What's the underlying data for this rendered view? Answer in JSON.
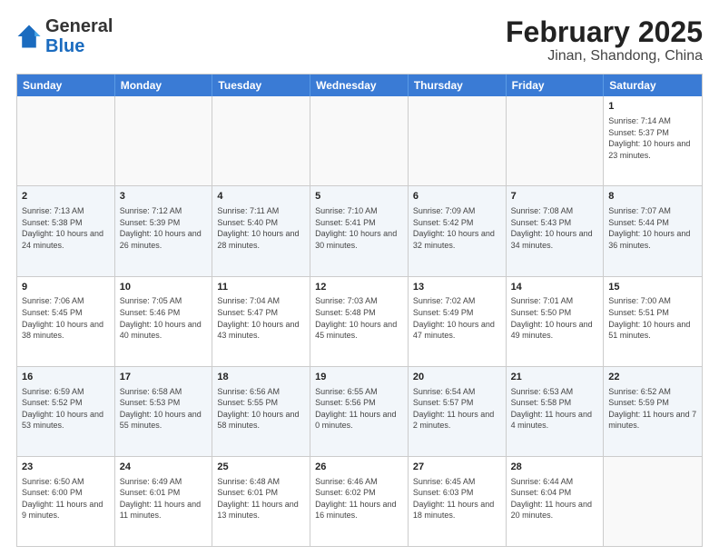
{
  "logo": {
    "general": "General",
    "blue": "Blue"
  },
  "title": "February 2025",
  "subtitle": "Jinan, Shandong, China",
  "weekdays": [
    "Sunday",
    "Monday",
    "Tuesday",
    "Wednesday",
    "Thursday",
    "Friday",
    "Saturday"
  ],
  "weeks": [
    [
      {
        "day": "",
        "text": "",
        "empty": true
      },
      {
        "day": "",
        "text": "",
        "empty": true
      },
      {
        "day": "",
        "text": "",
        "empty": true
      },
      {
        "day": "",
        "text": "",
        "empty": true
      },
      {
        "day": "",
        "text": "",
        "empty": true
      },
      {
        "day": "",
        "text": "",
        "empty": true
      },
      {
        "day": "1",
        "text": "Sunrise: 7:14 AM\nSunset: 5:37 PM\nDaylight: 10 hours and 23 minutes.",
        "empty": false
      }
    ],
    [
      {
        "day": "2",
        "text": "Sunrise: 7:13 AM\nSunset: 5:38 PM\nDaylight: 10 hours and 24 minutes.",
        "empty": false
      },
      {
        "day": "3",
        "text": "Sunrise: 7:12 AM\nSunset: 5:39 PM\nDaylight: 10 hours and 26 minutes.",
        "empty": false
      },
      {
        "day": "4",
        "text": "Sunrise: 7:11 AM\nSunset: 5:40 PM\nDaylight: 10 hours and 28 minutes.",
        "empty": false
      },
      {
        "day": "5",
        "text": "Sunrise: 7:10 AM\nSunset: 5:41 PM\nDaylight: 10 hours and 30 minutes.",
        "empty": false
      },
      {
        "day": "6",
        "text": "Sunrise: 7:09 AM\nSunset: 5:42 PM\nDaylight: 10 hours and 32 minutes.",
        "empty": false
      },
      {
        "day": "7",
        "text": "Sunrise: 7:08 AM\nSunset: 5:43 PM\nDaylight: 10 hours and 34 minutes.",
        "empty": false
      },
      {
        "day": "8",
        "text": "Sunrise: 7:07 AM\nSunset: 5:44 PM\nDaylight: 10 hours and 36 minutes.",
        "empty": false
      }
    ],
    [
      {
        "day": "9",
        "text": "Sunrise: 7:06 AM\nSunset: 5:45 PM\nDaylight: 10 hours and 38 minutes.",
        "empty": false
      },
      {
        "day": "10",
        "text": "Sunrise: 7:05 AM\nSunset: 5:46 PM\nDaylight: 10 hours and 40 minutes.",
        "empty": false
      },
      {
        "day": "11",
        "text": "Sunrise: 7:04 AM\nSunset: 5:47 PM\nDaylight: 10 hours and 43 minutes.",
        "empty": false
      },
      {
        "day": "12",
        "text": "Sunrise: 7:03 AM\nSunset: 5:48 PM\nDaylight: 10 hours and 45 minutes.",
        "empty": false
      },
      {
        "day": "13",
        "text": "Sunrise: 7:02 AM\nSunset: 5:49 PM\nDaylight: 10 hours and 47 minutes.",
        "empty": false
      },
      {
        "day": "14",
        "text": "Sunrise: 7:01 AM\nSunset: 5:50 PM\nDaylight: 10 hours and 49 minutes.",
        "empty": false
      },
      {
        "day": "15",
        "text": "Sunrise: 7:00 AM\nSunset: 5:51 PM\nDaylight: 10 hours and 51 minutes.",
        "empty": false
      }
    ],
    [
      {
        "day": "16",
        "text": "Sunrise: 6:59 AM\nSunset: 5:52 PM\nDaylight: 10 hours and 53 minutes.",
        "empty": false
      },
      {
        "day": "17",
        "text": "Sunrise: 6:58 AM\nSunset: 5:53 PM\nDaylight: 10 hours and 55 minutes.",
        "empty": false
      },
      {
        "day": "18",
        "text": "Sunrise: 6:56 AM\nSunset: 5:55 PM\nDaylight: 10 hours and 58 minutes.",
        "empty": false
      },
      {
        "day": "19",
        "text": "Sunrise: 6:55 AM\nSunset: 5:56 PM\nDaylight: 11 hours and 0 minutes.",
        "empty": false
      },
      {
        "day": "20",
        "text": "Sunrise: 6:54 AM\nSunset: 5:57 PM\nDaylight: 11 hours and 2 minutes.",
        "empty": false
      },
      {
        "day": "21",
        "text": "Sunrise: 6:53 AM\nSunset: 5:58 PM\nDaylight: 11 hours and 4 minutes.",
        "empty": false
      },
      {
        "day": "22",
        "text": "Sunrise: 6:52 AM\nSunset: 5:59 PM\nDaylight: 11 hours and 7 minutes.",
        "empty": false
      }
    ],
    [
      {
        "day": "23",
        "text": "Sunrise: 6:50 AM\nSunset: 6:00 PM\nDaylight: 11 hours and 9 minutes.",
        "empty": false
      },
      {
        "day": "24",
        "text": "Sunrise: 6:49 AM\nSunset: 6:01 PM\nDaylight: 11 hours and 11 minutes.",
        "empty": false
      },
      {
        "day": "25",
        "text": "Sunrise: 6:48 AM\nSunset: 6:01 PM\nDaylight: 11 hours and 13 minutes.",
        "empty": false
      },
      {
        "day": "26",
        "text": "Sunrise: 6:46 AM\nSunset: 6:02 PM\nDaylight: 11 hours and 16 minutes.",
        "empty": false
      },
      {
        "day": "27",
        "text": "Sunrise: 6:45 AM\nSunset: 6:03 PM\nDaylight: 11 hours and 18 minutes.",
        "empty": false
      },
      {
        "day": "28",
        "text": "Sunrise: 6:44 AM\nSunset: 6:04 PM\nDaylight: 11 hours and 20 minutes.",
        "empty": false
      },
      {
        "day": "",
        "text": "",
        "empty": true
      }
    ]
  ]
}
